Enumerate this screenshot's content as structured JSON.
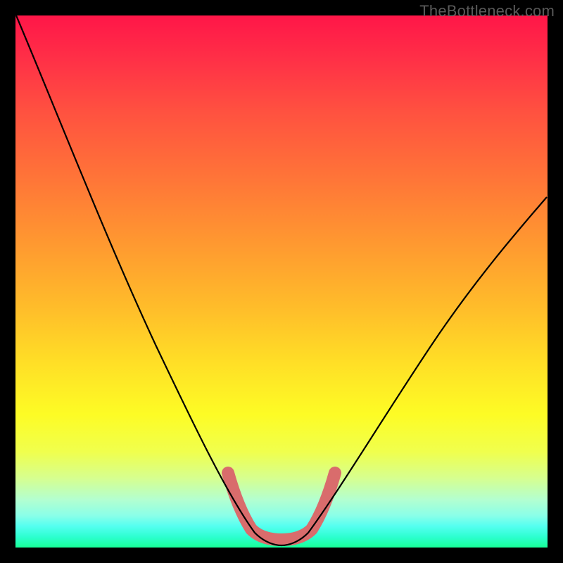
{
  "watermark": "TheBottleneck.com",
  "chart_data": {
    "type": "line",
    "title": "",
    "xlabel": "",
    "ylabel": "",
    "xlim": [
      0,
      100
    ],
    "ylim": [
      0,
      100
    ],
    "series": [
      {
        "name": "black-curve",
        "x": [
          0,
          5,
          10,
          15,
          20,
          25,
          30,
          35,
          40,
          43,
          46,
          50,
          54,
          57,
          60,
          65,
          70,
          75,
          80,
          85,
          90,
          95,
          100
        ],
        "values": [
          100,
          90,
          80,
          70,
          60,
          50,
          40,
          29,
          16,
          8,
          3,
          1,
          3,
          8,
          15,
          24,
          33,
          41,
          48,
          54,
          59,
          63,
          66
        ]
      },
      {
        "name": "bottleneck-band",
        "x": [
          40,
          42,
          44,
          46,
          48,
          50,
          52,
          54,
          56,
          58,
          60
        ],
        "values": [
          14,
          9,
          5,
          3,
          2,
          2,
          2,
          3,
          5,
          9,
          14
        ]
      }
    ],
    "colors": {
      "gradient_top": "#ff1648",
      "gradient_bottom": "#17ff98",
      "curve": "#000000",
      "band": "#d96c6c"
    }
  }
}
